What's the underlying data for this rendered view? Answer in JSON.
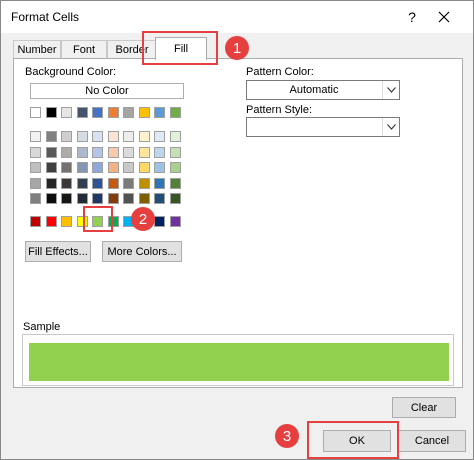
{
  "window": {
    "title": "Format Cells",
    "help_glyph": "?"
  },
  "tabs": [
    {
      "label": "Number"
    },
    {
      "label": "Font"
    },
    {
      "label": "Border"
    },
    {
      "label": "Fill",
      "active": true
    }
  ],
  "fill": {
    "background_color_label": "Background Color:",
    "no_color_label": "No Color",
    "theme_top_row": [
      "#ffffff",
      "#000000",
      "#e7e6e6",
      "#44546a",
      "#4472c4",
      "#ed7d31",
      "#a5a5a5",
      "#ffc000",
      "#5b9bd5",
      "#70ad47"
    ],
    "theme_shades": [
      [
        "#f2f2f2",
        "#808080",
        "#d0cece",
        "#d6dce4",
        "#d9e2f3",
        "#fbe4d5",
        "#ededed",
        "#fff2cc",
        "#deeaf6",
        "#e2efd9"
      ],
      [
        "#d9d9d9",
        "#595959",
        "#aeabab",
        "#adb9ca",
        "#b4c6e7",
        "#f7caac",
        "#dbdbdb",
        "#ffe599",
        "#bdd6ee",
        "#c5e0b3"
      ],
      [
        "#bfbfbf",
        "#404040",
        "#757070",
        "#8496b0",
        "#8eaadb",
        "#f4b183",
        "#c9c9c9",
        "#ffd965",
        "#9cc2e5",
        "#a8d08d"
      ],
      [
        "#a6a6a6",
        "#262626",
        "#3a3838",
        "#323f4f",
        "#2f5496",
        "#c45911",
        "#7b7b7b",
        "#bf8f00",
        "#2e75b5",
        "#538135"
      ],
      [
        "#7f7f7f",
        "#0d0d0d",
        "#161616",
        "#222a35",
        "#1f3864",
        "#833c0b",
        "#525252",
        "#7f6000",
        "#1f4e79",
        "#375623"
      ]
    ],
    "standard_colors": [
      "#c00000",
      "#ff0000",
      "#ffc000",
      "#ffff00",
      "#92d050",
      "#00b050",
      "#00b0f0",
      "#0070c0",
      "#002060",
      "#7030a0"
    ],
    "selected_color": "#92d050",
    "fill_effects_label": "Fill Effects...",
    "more_colors_label": "More Colors...",
    "pattern_color_label": "Pattern Color:",
    "pattern_color_value": "Automatic",
    "pattern_style_label": "Pattern Style:",
    "pattern_style_value": "",
    "sample_label": "Sample",
    "clear_label": "Clear"
  },
  "footer": {
    "ok_label": "OK",
    "cancel_label": "Cancel"
  },
  "annotations": [
    {
      "number": "1"
    },
    {
      "number": "2"
    },
    {
      "number": "3"
    }
  ],
  "colors": {
    "annotation_red": "#e53f3f"
  }
}
